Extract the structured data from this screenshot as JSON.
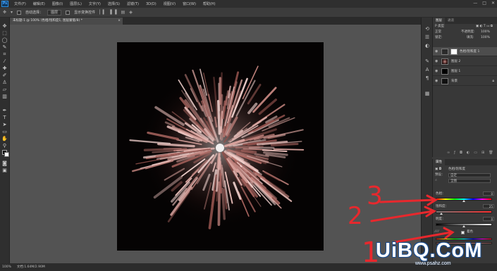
{
  "app": {
    "logo": "Ps"
  },
  "menu": [
    "文件(F)",
    "编辑(E)",
    "图像(I)",
    "图层(L)",
    "文字(Y)",
    "选择(S)",
    "滤镜(T)",
    "3D(D)",
    "视图(V)",
    "窗口(W)",
    "帮助(H)"
  ],
  "window_controls": [
    "—",
    "□",
    "✕"
  ],
  "options": {
    "auto_select": "自动选择：",
    "auto_select_target": "图层",
    "show_transform": "显示变换控件"
  },
  "document": {
    "tab_title": "未标题-1 @ 100% (色相/饱和度1, 图层蒙版/8) *",
    "close": "×"
  },
  "status": {
    "zoom": "100%",
    "doc_info": "文档:1.64M/2.90M"
  },
  "layers_panel": {
    "tabs": [
      "图层",
      "通道"
    ],
    "filter_label": "P 类型",
    "mode": "正常",
    "opacity_label": "不透明度:",
    "opacity_value": "100%",
    "lock_label": "锁定:",
    "fill_label": "填充:",
    "fill_value": "100%",
    "layers": [
      {
        "name": "色相/饱和度 1",
        "selected": true
      },
      {
        "name": "图层 2",
        "selected": false
      },
      {
        "name": "图层 1",
        "selected": false
      },
      {
        "name": "背景",
        "selected": false
      }
    ]
  },
  "properties_panel": {
    "title": "属性",
    "adjustment": "色相/饱和度",
    "preset_label": "预设：",
    "preset_value": "自定",
    "channel_value": "全图",
    "hue_label": "色相：",
    "hue_value": "0",
    "saturation_label": "饱和度：",
    "saturation_value": "25",
    "lightness_label": "明度：",
    "lightness_value": "0",
    "colorize_label": "着色"
  },
  "annotations": {
    "marks": [
      "3",
      "2",
      "1"
    ],
    "color": "#e8282d"
  },
  "watermark": {
    "main": "UiBQ.CoM",
    "sub": "www.psahz.com"
  }
}
